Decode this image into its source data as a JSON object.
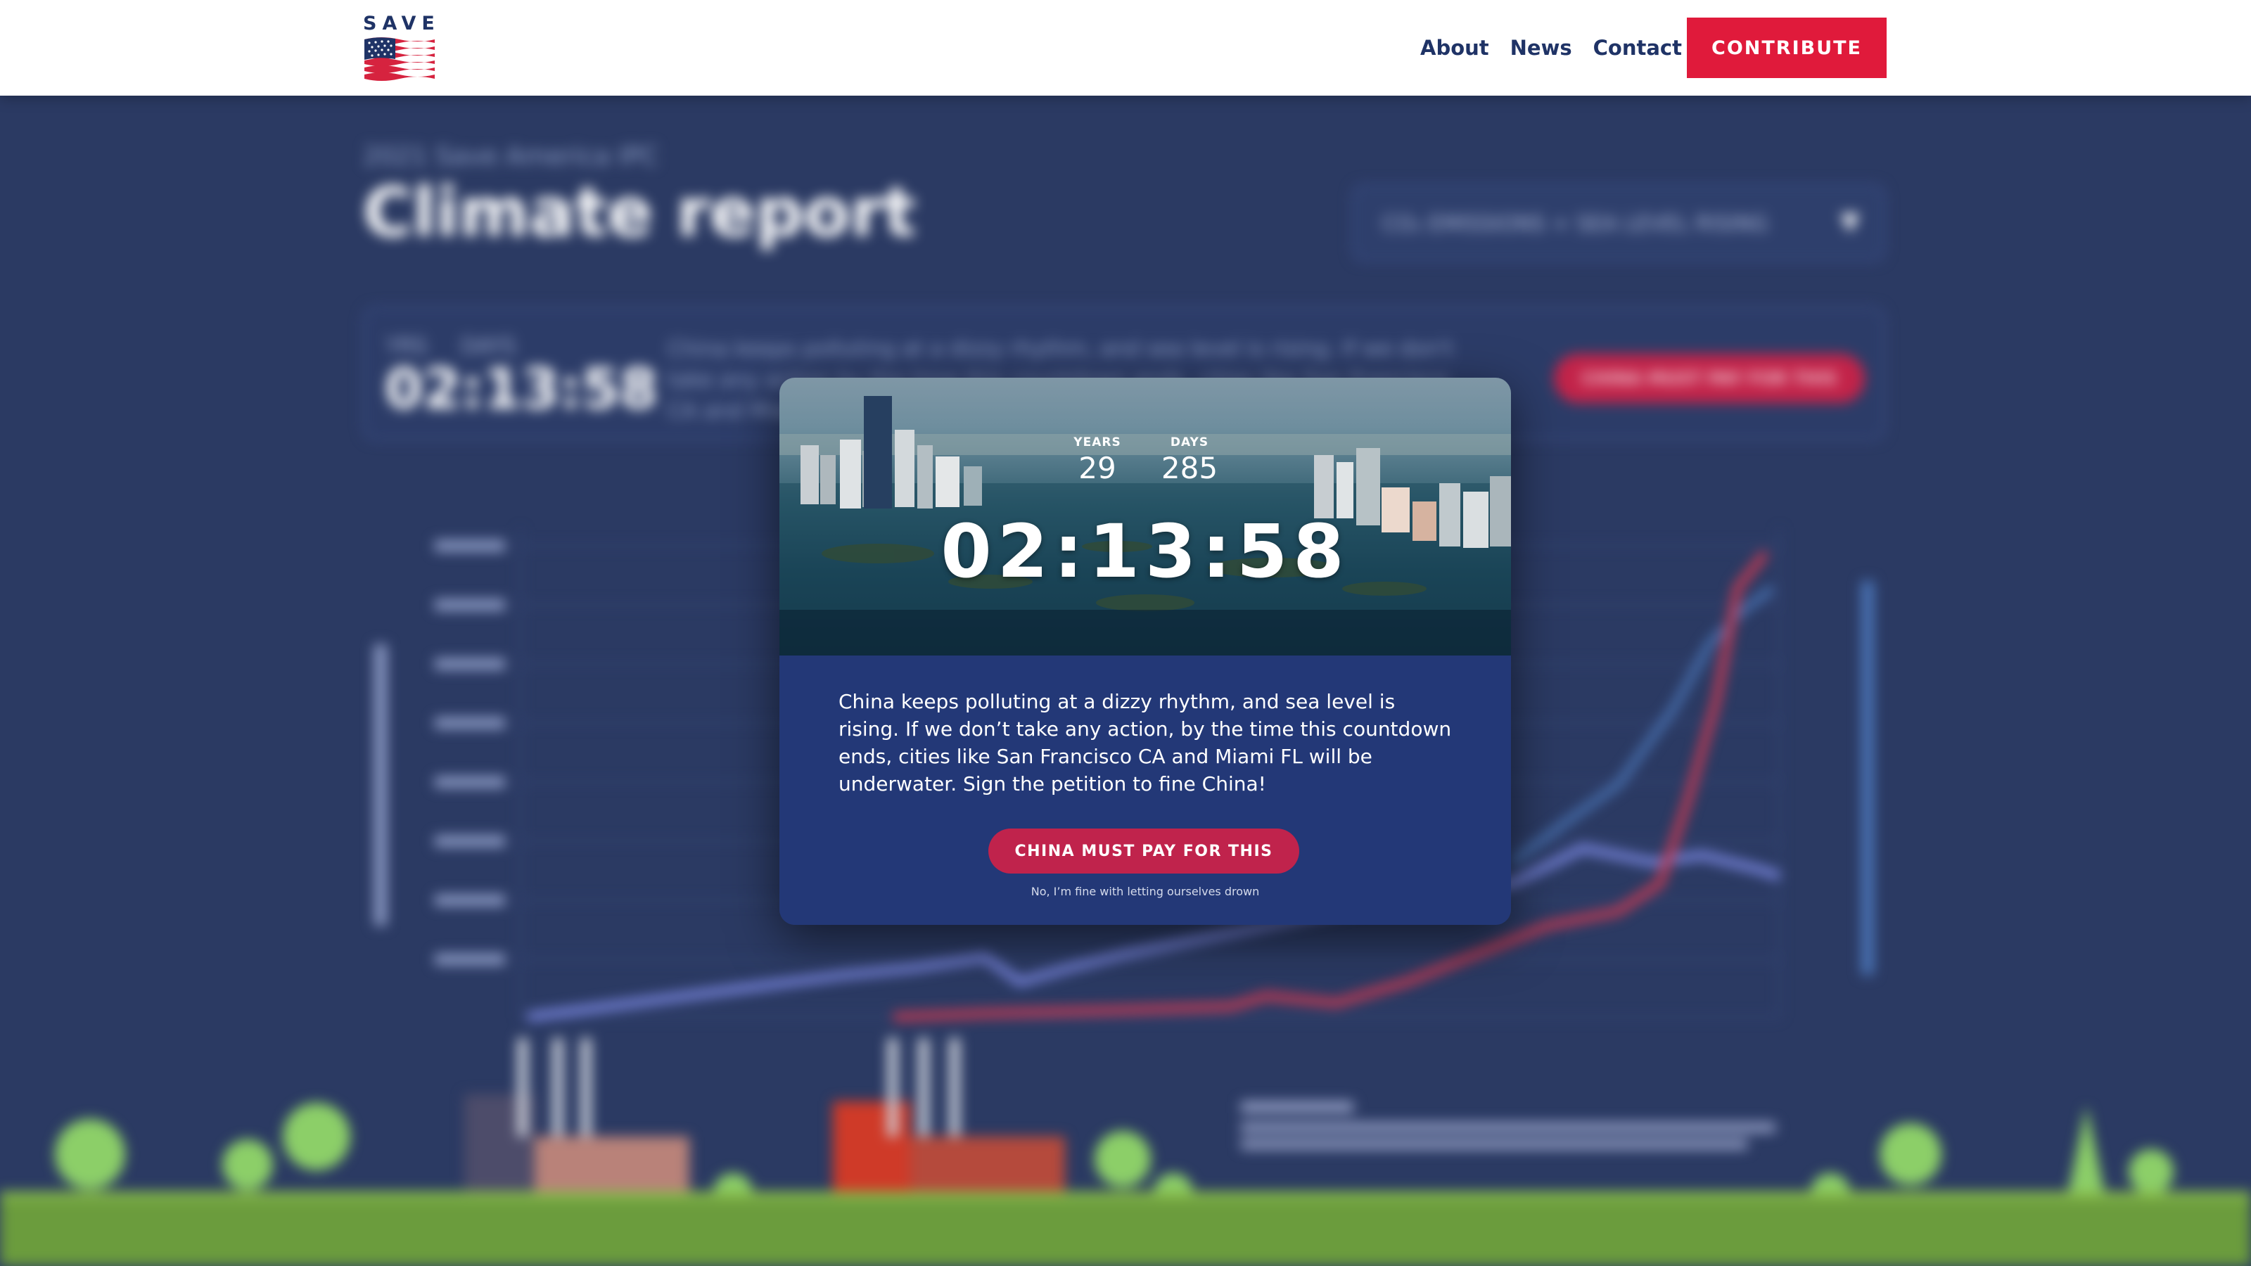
{
  "header": {
    "logo_text": "SAVE",
    "nav": [
      {
        "label": "About"
      },
      {
        "label": "News"
      },
      {
        "label": "Contact"
      }
    ],
    "contribute_label": "CONTRIBUTE"
  },
  "background": {
    "subtitle": "2021 Save America IPC",
    "title": "Climate report",
    "select_value": "CO₂ EMISSIONS + SEA LEVEL RISING",
    "banner": {
      "years_label": "YRS",
      "days_label": "DAYS",
      "timer": "02:13:58",
      "text": "China keeps polluting at a dizzy rhythm, and sea level is rising. If we don't take any action by the time this countdown ends, cities like San Francisco CA and Miami FL will be underwater.",
      "button_label": "CHINA MUST PAY FOR THIS"
    }
  },
  "modal": {
    "years_label": "YEARS",
    "years_value": "29",
    "days_label": "DAYS",
    "days_value": "285",
    "clock": "02:13:58",
    "message": "China keeps polluting at a dizzy rhythm, and sea level is rising. If we don’t take any action, by the time this countdown ends, cities like San Francisco CA and Miami FL will be underwater. Sign the petition to fine China!",
    "cta_label": "CHINA MUST PAY FOR THIS",
    "dismiss_label": "No, I’m fine with letting ourselves drown"
  },
  "colors": {
    "brand_navy": "#1f3366",
    "brand_red": "#e01a3b",
    "modal_body": "#233877",
    "cta": "#c0234c",
    "page_bg": "#2b3a63"
  }
}
